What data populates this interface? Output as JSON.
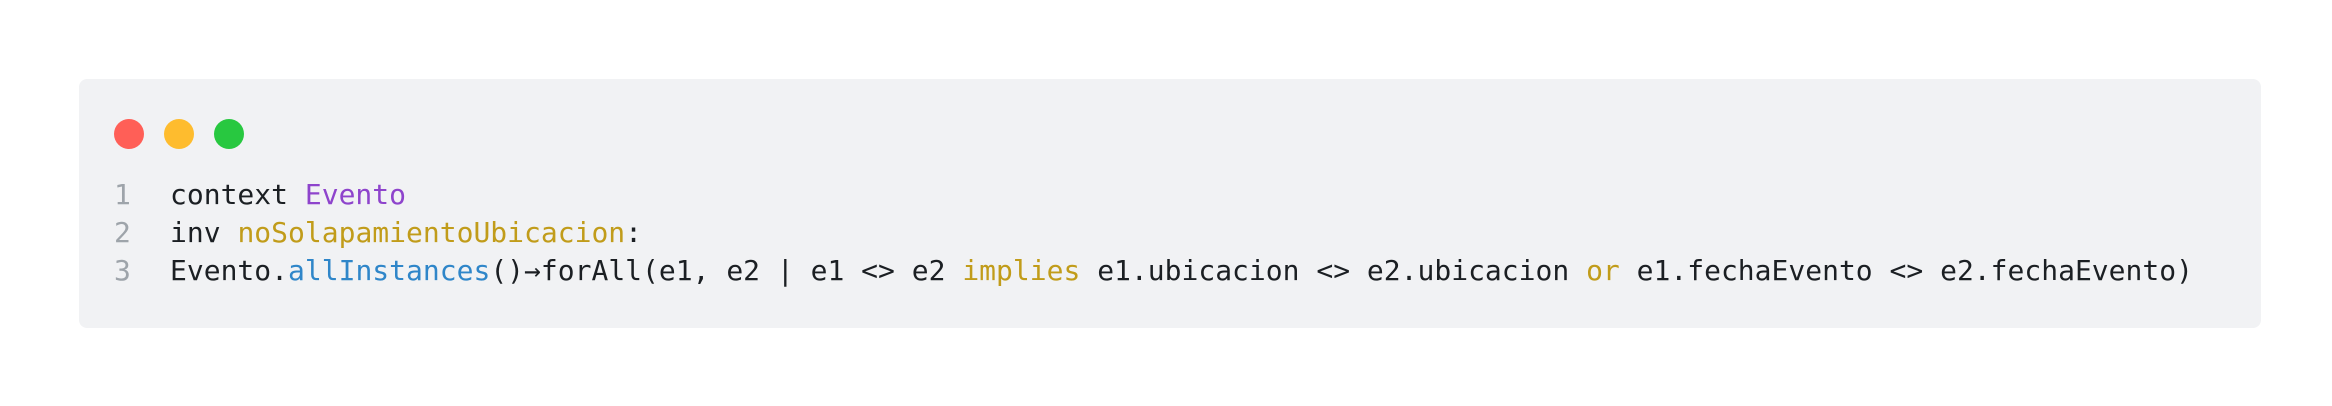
{
  "colors": {
    "close": "#ff5f57",
    "minimize": "#febc2e",
    "zoom": "#28c840",
    "type_token": "#8e44cc",
    "name_token": "#c19c1a",
    "function_token": "#2f86c9"
  },
  "code": {
    "lines": [
      {
        "number": "1",
        "tokens": [
          {
            "text": "context ",
            "kind": "plain"
          },
          {
            "text": "Evento",
            "kind": "type"
          }
        ]
      },
      {
        "number": "2",
        "tokens": [
          {
            "text": "inv ",
            "kind": "plain"
          },
          {
            "text": "noSolapamientoUbicacion",
            "kind": "name"
          },
          {
            "text": ":",
            "kind": "plain"
          }
        ]
      },
      {
        "number": "3",
        "tokens": [
          {
            "text": "Evento.",
            "kind": "plain"
          },
          {
            "text": "allInstances",
            "kind": "fn"
          },
          {
            "text": "()→forAll(e1, e2 | e1 <> e2 ",
            "kind": "plain"
          },
          {
            "text": "implies",
            "kind": "name"
          },
          {
            "text": " e1.ubicacion <> e2.ubicacion ",
            "kind": "plain"
          },
          {
            "text": "or",
            "kind": "name"
          },
          {
            "text": " e1.fechaEvento <> e2.fechaEvento)",
            "kind": "plain"
          }
        ]
      }
    ]
  }
}
